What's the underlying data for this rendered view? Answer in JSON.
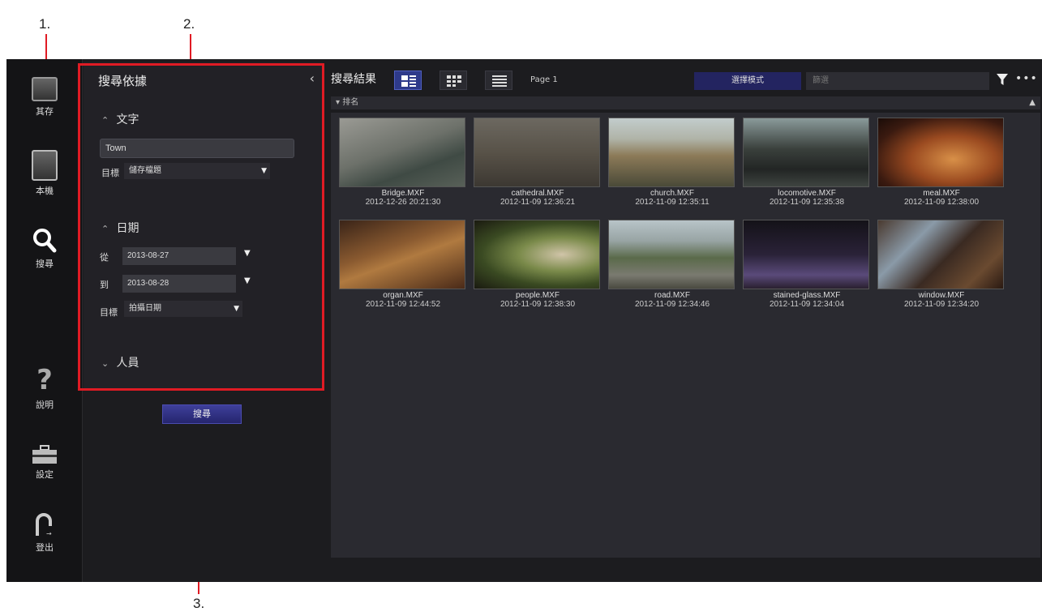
{
  "callouts": {
    "c1": "1.",
    "c2": "2.",
    "c3": "3."
  },
  "nav": {
    "items": [
      {
        "label": "其存",
        "icon": "storage-icon"
      },
      {
        "label": "本機",
        "icon": "local-drive-icon"
      },
      {
        "label": "搜尋",
        "icon": "search-icon"
      },
      {
        "label": "說明",
        "icon": "help-icon"
      },
      {
        "label": "設定",
        "icon": "toolbox-icon"
      },
      {
        "label": "登出",
        "icon": "logout-icon"
      }
    ]
  },
  "criteria": {
    "title": "搜尋依據",
    "collapse_glyph": "‹",
    "text_section": {
      "label": "文字",
      "chevron": "⌃",
      "value": "Town",
      "target_label": "目標",
      "target_value": "儲存檔題"
    },
    "date_section": {
      "label": "日期",
      "chevron": "⌃",
      "from_label": "從",
      "from_value": "2013-08-27",
      "to_label": "到",
      "to_value": "2013-08-28",
      "target_label": "目標",
      "target_value": "拍攝日期"
    },
    "person_section": {
      "label": "人員",
      "chevron": "⌄"
    },
    "search_button": "搜尋"
  },
  "results": {
    "title": "搜尋結果",
    "page_label": "Page 1",
    "mode_button": "選擇模式",
    "filter_placeholder": "篩選",
    "more_glyph": "•••",
    "sort_label": "排名",
    "items": [
      {
        "name": "Bridge.MXF",
        "date": "2012-12-26 20:21:30"
      },
      {
        "name": "cathedral.MXF",
        "date": "2012-11-09 12:36:21"
      },
      {
        "name": "church.MXF",
        "date": "2012-11-09 12:35:11"
      },
      {
        "name": "locomotive.MXF",
        "date": "2012-11-09 12:35:38"
      },
      {
        "name": "meal.MXF",
        "date": "2012-11-09 12:38:00"
      },
      {
        "name": "organ.MXF",
        "date": "2012-11-09 12:44:52"
      },
      {
        "name": "people.MXF",
        "date": "2012-11-09 12:38:30"
      },
      {
        "name": "road.MXF",
        "date": "2012-11-09 12:34:46"
      },
      {
        "name": "stained-glass.MXF",
        "date": "2012-11-09 12:34:04"
      },
      {
        "name": "window.MXF",
        "date": "2012-11-09 12:34:20"
      }
    ]
  },
  "colors": {
    "accent_red": "#e01b24",
    "button_blue": "#2e3a8a",
    "background": "#1c1c1f"
  }
}
